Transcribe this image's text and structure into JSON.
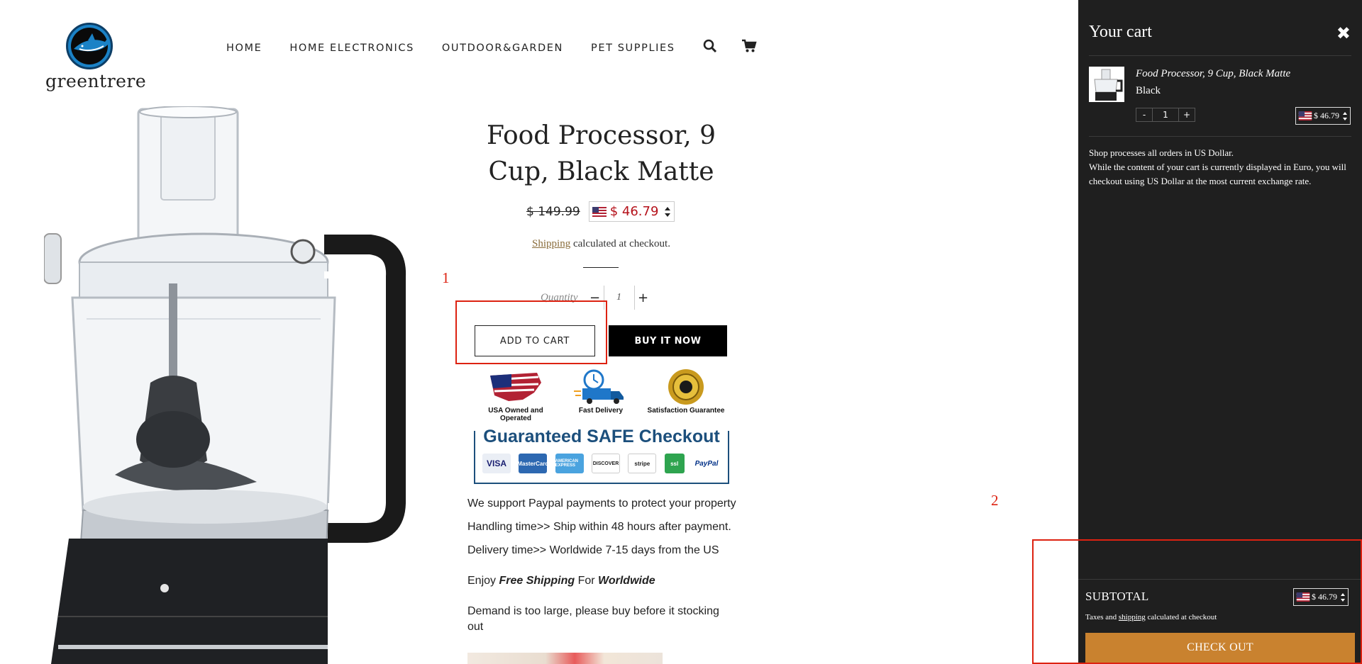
{
  "brand": {
    "name": "greentrere"
  },
  "nav": {
    "items": [
      "HOME",
      "HOME ELECTRONICS",
      "OUTDOOR&GARDEN",
      "PET SUPPLIES"
    ],
    "search_icon": "search-icon",
    "cart_icon": "cart-icon"
  },
  "product": {
    "title": "Food Processor, 9 Cup, Black Matte",
    "old_price": "$ 149.99",
    "price": "$ 46.79",
    "shipping_link": "Shipping",
    "shipping_text": " calculated at checkout.",
    "quantity_label": "Quantity",
    "quantity_minus": "−",
    "quantity_value": "1",
    "quantity_plus": "+",
    "add_to_cart": "ADD TO CART",
    "buy_now": "BUY IT NOW",
    "badges": [
      "USA Owned and Operated",
      "Fast Delivery",
      "Satisfaction Guarantee"
    ],
    "safe_checkout_title": "Guaranteed SAFE Checkout",
    "payment_cards": [
      "VISA",
      "MasterCard",
      "AMERICAN EXPRESS",
      "DISCOVER",
      "stripe",
      "ssl",
      "PayPal"
    ],
    "desc_lines": [
      "We support Paypal payments to protect your property",
      "Handling time>> Ship within 48 hours after payment.",
      "Delivery time>> Worldwide 7-15 days from the US"
    ],
    "free_shipping": {
      "pre": "Enjoy ",
      "b1": "Free Shipping",
      "mid": " For ",
      "b2": "Worldwide"
    },
    "demand_note": "Demand is too large, please buy before it stocking out"
  },
  "annotations": [
    "1",
    "2"
  ],
  "cart": {
    "title": "Your cart",
    "close_icon": "close-icon",
    "item": {
      "name": "Food Processor, 9 Cup, Black Matte",
      "variant": "Black",
      "qty_minus": "-",
      "qty": "1",
      "qty_plus": "+",
      "price": "$ 46.79"
    },
    "note_1": "Shop processes all orders in US Dollar.",
    "note_2": "While the content of your cart is currently displayed in Euro, you will checkout using US Dollar at the most current exchange rate.",
    "subtotal_label": "SUBTOTAL",
    "subtotal_price": "$ 46.79",
    "tax_pre": "Taxes and ",
    "tax_link": "shipping",
    "tax_post": " calculated at checkout",
    "checkout_label": "CHECK OUT"
  },
  "colors": {
    "accent_red": "#b5121b",
    "checkout": "#c9822f",
    "drawer_bg": "#1f1f1f",
    "annotation": "#dd2211"
  }
}
